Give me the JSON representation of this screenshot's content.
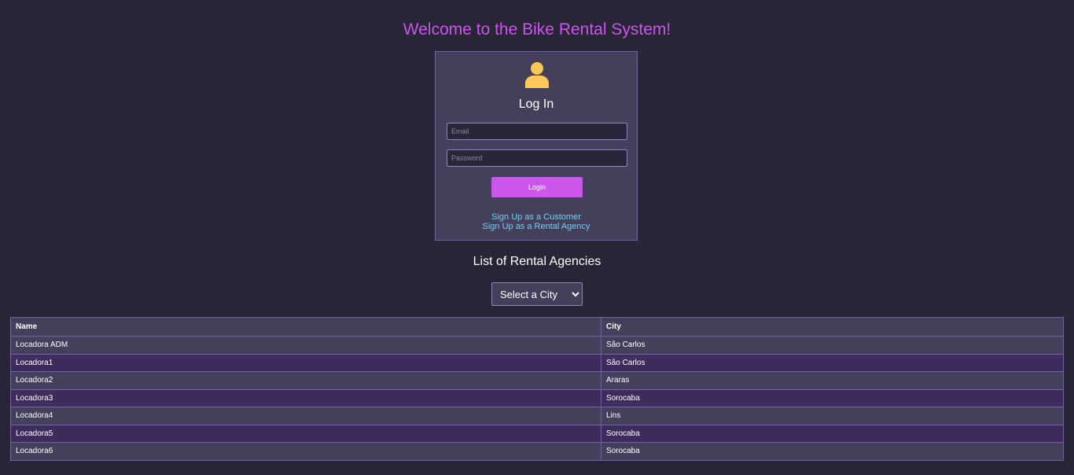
{
  "page": {
    "title": "Welcome to the Bike Rental System!"
  },
  "login": {
    "icon": "user-icon",
    "heading": "Log In",
    "email_placeholder": "Email",
    "password_placeholder": "Password",
    "button_label": "Login",
    "signup_customer_label": "Sign Up as a Customer",
    "signup_agency_label": "Sign Up as a Rental Agency"
  },
  "agencies": {
    "heading": "List of Rental Agencies",
    "city_select": {
      "selected": "Select a City",
      "options": [
        "Select a City"
      ]
    },
    "columns": [
      "Name",
      "City"
    ],
    "rows": [
      {
        "name": "Locadora ADM",
        "city": "São Carlos"
      },
      {
        "name": "Locadora1",
        "city": "São Carlos"
      },
      {
        "name": "Locadora2",
        "city": "Araras"
      },
      {
        "name": "Locadora3",
        "city": "Sorocaba"
      },
      {
        "name": "Locadora4",
        "city": "Lins"
      },
      {
        "name": "Locadora5",
        "city": "Sorocaba"
      },
      {
        "name": "Locadora6",
        "city": "Sorocaba"
      }
    ]
  },
  "colors": {
    "background": "#282536",
    "accent": "#cc55ee",
    "card": "#453f5b",
    "link": "#6fd3f6",
    "icon": "#ffc75a"
  }
}
